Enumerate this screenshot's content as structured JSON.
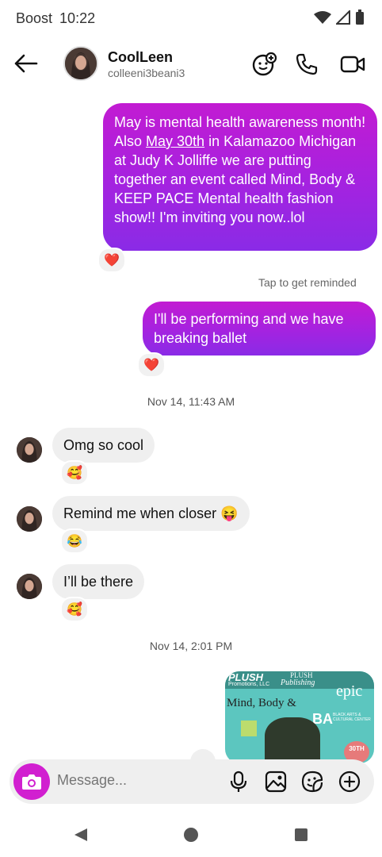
{
  "status": {
    "carrier": "Boost",
    "time": "10:22"
  },
  "header": {
    "name": "CoolLeen",
    "handle": "colleeni3beani3"
  },
  "messages": {
    "m1": {
      "pre": "May is mental health awareness month! Also ",
      "link": "May 30th",
      "post": " in Kalamazoo Michigan at Judy K Jolliffe we are putting together an event called Mind, Body & KEEP PACE Mental health fashion show!! I'm inviting you now..lol",
      "reaction": "❤️"
    },
    "hint": "Tap to get reminded",
    "m2": {
      "text": "I'll be performing and we have breaking ballet",
      "reaction": "❤️"
    },
    "ts1": "Nov 14, 11:43 AM",
    "m3": {
      "text": "Omg so cool",
      "reaction": "🥰"
    },
    "m4": {
      "text": "Remind me when closer 😝",
      "reaction": "😂"
    },
    "m5": {
      "text": "I’ll be there",
      "reaction": "🥰"
    },
    "ts2": "Nov 14, 2:01 PM",
    "image": {
      "brand_left": "PLUSH",
      "brand_left_sub": "Promotions, LLC",
      "brand_mid": "PLUSH",
      "brand_mid_sub": "Publishing",
      "title": "Mind, Body &",
      "epic": "epic",
      "center": "BLACK ARTS & CULTURAL CENTER",
      "date_badge": "30TH"
    }
  },
  "composer": {
    "placeholder": "Message..."
  },
  "colors": {
    "accent": "#d11fd0",
    "gradient_top": "#c21bd2",
    "gradient_bottom": "#8a2be6",
    "incoming_bg": "#efefef"
  }
}
